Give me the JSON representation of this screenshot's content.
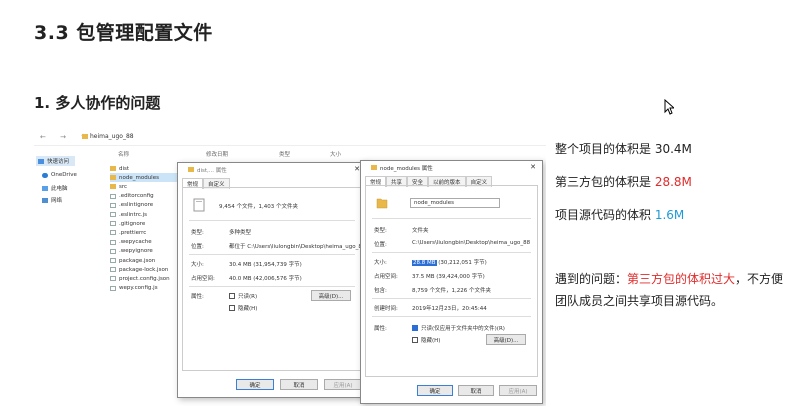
{
  "heading": "3.3 包管理配置文件",
  "subheading": "1. 多人协作的问题",
  "explorer": {
    "path": "heima_ugo_88",
    "nav_arrows": "← → ↑",
    "nav_items": [
      "快速访问",
      "OneDrive",
      "此电脑",
      "网络"
    ],
    "col_name": "名称",
    "col_date": "修改日期",
    "col_type": "类型",
    "col_size": "大小",
    "files": [
      {
        "name": "dist",
        "kind": "folder"
      },
      {
        "name": "node_modules",
        "kind": "folder"
      },
      {
        "name": "src",
        "kind": "folder"
      },
      {
        "name": ".editorconfig",
        "kind": "doc"
      },
      {
        "name": ".eslintignore",
        "kind": "doc"
      },
      {
        "name": ".eslintrc.js",
        "kind": "doc"
      },
      {
        "name": ".gitignore",
        "kind": "doc"
      },
      {
        "name": ".prettierrc",
        "kind": "doc"
      },
      {
        "name": ".wepycache",
        "kind": "doc"
      },
      {
        "name": ".wepyignore",
        "kind": "doc"
      },
      {
        "name": "package.json",
        "kind": "doc"
      },
      {
        "name": "package-lock.json",
        "kind": "doc"
      },
      {
        "name": "project.config.json",
        "kind": "doc"
      },
      {
        "name": "wepy.config.js",
        "kind": "doc"
      }
    ]
  },
  "dialog1": {
    "title": "dist,... 属性",
    "tabs": [
      "常规",
      "自定义"
    ],
    "summary": "9,454 个文件，1,403 个文件夹",
    "type_label": "类型:",
    "type_value": "多种类型",
    "loc_label": "位置:",
    "loc_value": "都位于 C:\\Users\\liulongbin\\Desktop\\heima_ugo_88",
    "size_label": "大小:",
    "size_value": "30.4 MB (31,954,739 字节)",
    "disk_label": "占用空间:",
    "disk_value": "40.0 MB (42,006,576 字节)",
    "attr_label": "属性:",
    "readonly": "只读(R)",
    "hidden": "隐藏(H)",
    "advanced": "高级(D)...",
    "ok": "确定",
    "cancel": "取消",
    "apply": "应用(A)"
  },
  "dialog2": {
    "title": "node_modules 属性",
    "tabs": [
      "常规",
      "共享",
      "安全",
      "以前的版本",
      "自定义"
    ],
    "name_value": "node_modules",
    "type_label": "类型:",
    "type_value": "文件夹",
    "loc_label": "位置:",
    "loc_value": "C:\\Users\\liulongbin\\Desktop\\heima_ugo_88",
    "size_label": "大小:",
    "size_hl": "28.8 MB",
    "size_rest": " (30,212,051 字节)",
    "disk_label": "占用空间:",
    "disk_value": "37.5 MB (39,424,000 字节)",
    "contains_label": "包含:",
    "contains_value": "8,759 个文件，1,226 个文件夹",
    "created_label": "创建时间:",
    "created_value": "2019年12月23日，20:45:44",
    "attr_label": "属性:",
    "readonly": "只读(仅应用于文件夹中的文件)(R)",
    "hidden": "隐藏(H)",
    "advanced": "高级(D)...",
    "ok": "确定",
    "cancel": "取消",
    "apply": "应用(A)"
  },
  "notes": {
    "total_prefix": "整个项目的体积是 ",
    "total_value": "30.4M",
    "third_prefix": "第三方包的体积是 ",
    "third_value": "28.8M",
    "src_prefix": "项目源代码的体积 ",
    "src_value": "1.6M",
    "problem_prefix": "遇到的问题：",
    "problem_highlight": "第三方包的体积过大",
    "problem_rest": "，不方便团队成员之间共享项目源代码。"
  },
  "colors": {
    "red": "#e02b2b",
    "blue": "#1e9ad6",
    "folder": "#e8b84a",
    "selection": "#2b6fd6"
  }
}
